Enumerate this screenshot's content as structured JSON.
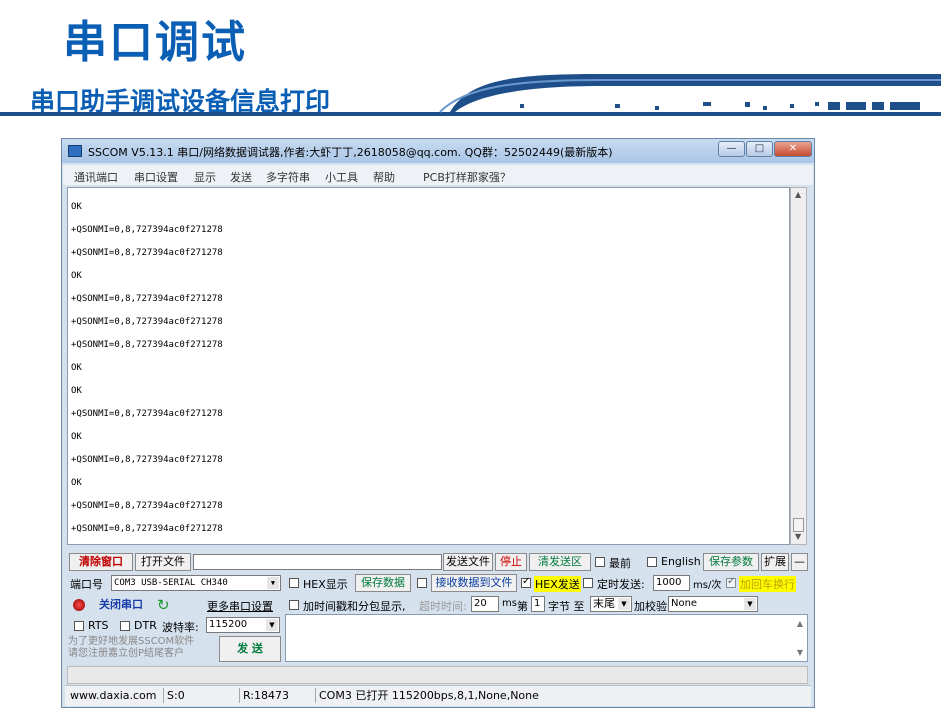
{
  "slide": {
    "title": "串口调试",
    "subtitle": "串口助手调试设备信息打印"
  },
  "window": {
    "title": "SSCOM V5.13.1 串口/网络数据调试器,作者:大虾丁丁,2618058@qq.com. QQ群：52502449(最新版本)",
    "min_label": "—",
    "max_label": "□",
    "close_label": "✕"
  },
  "menu": [
    "通讯端口",
    "串口设置",
    "显示",
    "发送",
    "多字符串",
    "小工具",
    "帮助",
    "PCB打样那家强？"
  ],
  "output_lines": [
    "OK",
    "+QSONMI=0,8,727394ac0f271278",
    "+QSONMI=0,8,727394ac0f271278",
    "OK",
    "+QSONMI=0,8,727394ac0f271278",
    "+QSONMI=0,8,727394ac0f271278",
    "+QSONMI=0,8,727394ac0f271278",
    "OK",
    "OK",
    "+QSONMI=0,8,727394ac0f271278",
    "OK",
    "+QSONMI=0,8,727394ac0f271278",
    "OK",
    "+QSONMI=0,8,727394ac0f271278",
    "+QSONMI=0,8,727394ac0f271278"
  ],
  "toolbar1": {
    "clear_window": "清除窗口",
    "open_file": "打开文件",
    "send_file": "发送文件",
    "stop": "停止",
    "clear_send": "清发送区",
    "topmost": "最前",
    "english": "English",
    "save_params": "保存参数",
    "expand": "扩展",
    "collapse": "—"
  },
  "row2": {
    "port_label": "端口号",
    "port_value": "COM3 USB-SERIAL CH340",
    "hex_display": "HEX显示",
    "save_data": "保存数据",
    "recv_to_file": "接收数据到文件",
    "hex_send": "HEX发送",
    "timed_send": "定时发送:",
    "interval": "1000",
    "interval_unit": "ms/次",
    "add_crlf": "加回车换行"
  },
  "row3": {
    "close_port": "关闭串口",
    "more_settings": "更多串口设置",
    "timestamp": "加时间戳和分包显示,",
    "timeout_label": "超时时间:",
    "timeout_value": "20",
    "timeout_unit": "ms",
    "nth_label": "第",
    "nth_value": "1",
    "byte_to": "字节 至",
    "end_value": "末尾",
    "checksum_label": "加校验",
    "checksum_value": "None"
  },
  "row4": {
    "rts": "RTS",
    "dtr": "DTR",
    "baud_label": "波特率:",
    "baud_value": "115200"
  },
  "promo": {
    "line1": "为了更好地发展SSCOM软件",
    "line2": "请您注册嘉立创P结尾客户",
    "send_button": "发  送"
  },
  "status": {
    "website": "www.daxia.com",
    "sent": "S:0",
    "received": "R:18473",
    "port_state": "COM3 已打开  115200bps,8,1,None,None"
  },
  "colors": {
    "brand_blue": "#0a5fb4",
    "hex_send_highlight": "#ffff00",
    "add_crlf_bg": "#ffff00"
  }
}
